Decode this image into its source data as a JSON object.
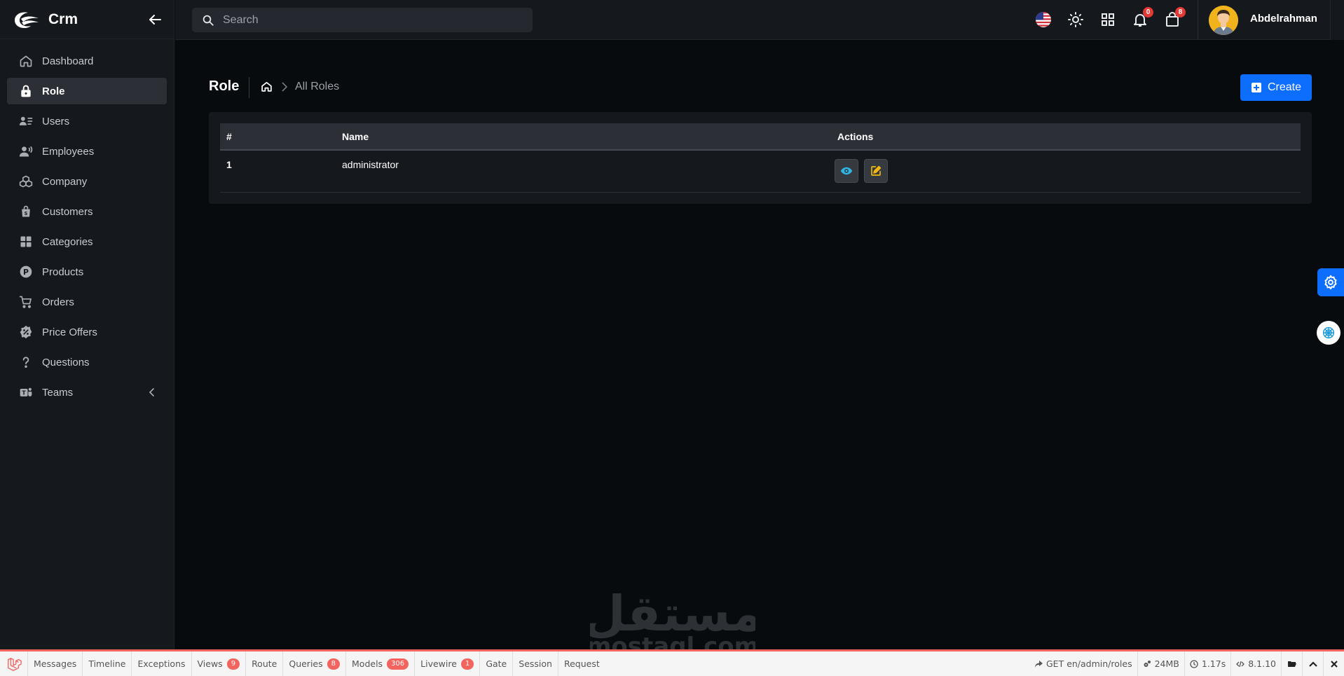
{
  "brand": {
    "name": "Crm"
  },
  "sidebar": {
    "items": [
      {
        "label": "Dashboard",
        "icon": "home-icon",
        "active": false
      },
      {
        "label": "Role",
        "icon": "lock-icon",
        "active": true
      },
      {
        "label": "Users",
        "icon": "users-list-icon",
        "active": false
      },
      {
        "label": "Employees",
        "icon": "employee-icon",
        "active": false
      },
      {
        "label": "Company",
        "icon": "boxes-icon",
        "active": false
      },
      {
        "label": "Customers",
        "icon": "shopping-bag-icon",
        "active": false
      },
      {
        "label": "Categories",
        "icon": "grid-icon",
        "active": false
      },
      {
        "label": "Products",
        "icon": "product-p-icon",
        "active": false
      },
      {
        "label": "Orders",
        "icon": "cart-icon",
        "active": false
      },
      {
        "label": "Price Offers",
        "icon": "percent-badge-icon",
        "active": false
      },
      {
        "label": "Questions",
        "icon": "question-icon",
        "active": false
      },
      {
        "label": "Teams",
        "icon": "teams-icon",
        "active": false
      }
    ]
  },
  "header": {
    "search_placeholder": "Search",
    "notifications_count": "0",
    "cart_count": "8",
    "username": "Abdelrahman"
  },
  "main": {
    "title": "Role",
    "breadcrumb_current": "All Roles",
    "create_label": "Create",
    "table": {
      "columns": [
        "#",
        "Name",
        "Actions"
      ],
      "rows": [
        {
          "num": "1",
          "name": "administrator"
        }
      ]
    }
  },
  "debugbar": {
    "tabs": [
      {
        "label": "Messages"
      },
      {
        "label": "Timeline"
      },
      {
        "label": "Exceptions"
      },
      {
        "label": "Views",
        "badge": "9"
      },
      {
        "label": "Route"
      },
      {
        "label": "Queries",
        "badge": "8"
      },
      {
        "label": "Models",
        "badge": "306"
      },
      {
        "label": "Livewire",
        "badge": "1"
      },
      {
        "label": "Gate"
      },
      {
        "label": "Session"
      },
      {
        "label": "Request"
      }
    ],
    "route": "GET en/admin/roles",
    "memory": "24MB",
    "time": "1.17s",
    "php_version": "8.1.10"
  },
  "watermark": {
    "arabic": "مستقل",
    "latin": "mostaql.com"
  },
  "colors": {
    "primary": "#0d6efd",
    "sidebar_bg": "#15181d",
    "page_bg": "#080b0e",
    "danger": "#e53935",
    "view_icon": "#2fb8e6",
    "edit_icon": "#f2b70f",
    "debug_accent": "#f4645f"
  }
}
